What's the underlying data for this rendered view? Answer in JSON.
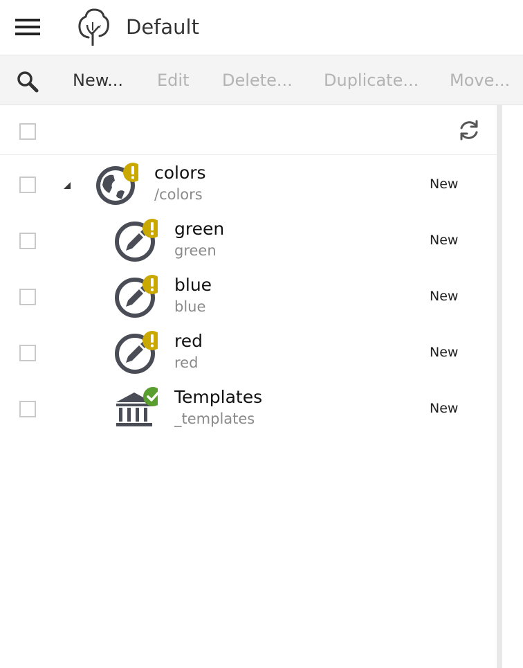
{
  "header": {
    "menu_icon": "hamburger-menu-icon",
    "logo_icon": "tree-logo-icon",
    "title": "Default"
  },
  "toolbar": {
    "search_icon": "search-icon",
    "new_label": "New...",
    "edit_label": "Edit",
    "delete_label": "Delete...",
    "duplicate_label": "Duplicate...",
    "move_label": "Move..."
  },
  "list": {
    "refresh_icon": "refresh-icon",
    "rows": [
      {
        "title": "colors",
        "subtitle": "/colors",
        "status": "New",
        "icon": "globe-icon",
        "badge": "warning",
        "expanded": true
      },
      {
        "title": "green",
        "subtitle": "green",
        "status": "New",
        "icon": "pencil-icon",
        "badge": "warning"
      },
      {
        "title": "blue",
        "subtitle": "blue",
        "status": "New",
        "icon": "pencil-icon",
        "badge": "warning"
      },
      {
        "title": "red",
        "subtitle": "red",
        "status": "New",
        "icon": "pencil-icon",
        "badge": "warning"
      },
      {
        "title": "Templates",
        "subtitle": "_templates",
        "status": "New",
        "icon": "bank-icon",
        "badge": "check"
      }
    ]
  },
  "colors": {
    "icon_dark": "#4a4d56",
    "warning_badge": "#c9a800",
    "check_badge": "#5a9e2f",
    "toolbar_bg": "#f4f4f4",
    "disabled_text": "#b3b3b3"
  }
}
